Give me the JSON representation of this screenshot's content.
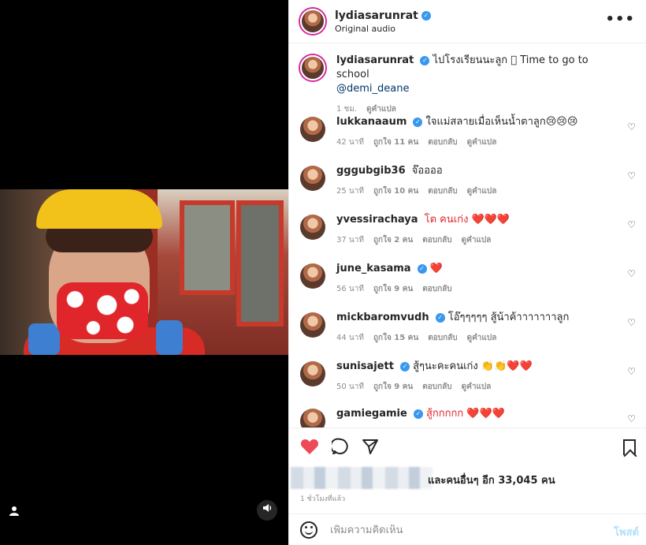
{
  "header": {
    "username": "lydiasarunrat",
    "subtitle": "Original audio",
    "more_label": "•••"
  },
  "caption": {
    "username": "lydiasarunrat",
    "text": "ไปโรงเรียนนะลูก 🏻 Time to go to school",
    "mention": "@demi_deane",
    "time": "1 ชม.",
    "translate": "ดูคำแปล"
  },
  "comments": [
    {
      "username": "lukkanaaum",
      "verified": true,
      "text": "ใจแม่สลายเมื่อเห็นน้ำตาลูก😢😢😢",
      "time": "42 นาที",
      "likes": "ถูกใจ 11 คน",
      "reply": "ตอบกลับ",
      "translate": "ดูคำแปล"
    },
    {
      "username": "gggubgib36",
      "verified": false,
      "text": "จ๊ออออ",
      "time": "25 นาที",
      "likes": "ถูกใจ 10 คน",
      "reply": "ตอบกลับ",
      "translate": "ดูคำแปล"
    },
    {
      "username": "yvessirachaya",
      "verified": false,
      "text": "โต คนเก่ง ❤️❤️❤️",
      "time": "37 นาที",
      "likes": "ถูกใจ 2 คน",
      "reply": "ตอบกลับ",
      "translate": "ดูคำแปล"
    },
    {
      "username": "june_kasama",
      "verified": true,
      "text": "❤️",
      "time": "56 นาที",
      "likes": "ถูกใจ 9 คน",
      "reply": "ตอบกลับ",
      "translate": ""
    },
    {
      "username": "mickbaromvudh",
      "verified": true,
      "text": "โอ๊ๆๆๆๆๆ สู้น้าค้าาาาาาาลูก",
      "time": "44 นาที",
      "likes": "ถูกใจ 15 คน",
      "reply": "ตอบกลับ",
      "translate": "ดูคำแปล"
    },
    {
      "username": "sunisajett",
      "verified": true,
      "text": "สู้ๆนะคะคนเก่ง 👏👏❤️❤️",
      "time": "50 นาที",
      "likes": "ถูกใจ 9 คน",
      "reply": "ตอบกลับ",
      "translate": "ดูคำแปล"
    },
    {
      "username": "gamiegamie",
      "verified": true,
      "text": "สู้กกกกก ❤️❤️❤️",
      "time": "",
      "likes": "",
      "reply": "",
      "translate": ""
    }
  ],
  "actions": {
    "likes_text": "และคนอื่นๆ อีก 33,045 คน",
    "time_ago": "1 ชั่วโมงที่แล้ว",
    "comment_placeholder": "เพิ่มความคิดเห็น",
    "post_label": "โพสต์"
  },
  "colors": {
    "verified": "#3897f0",
    "like_red": "#ed4956",
    "post_disabled": "#b2dffc"
  },
  "icons": {
    "like": "heart-filled-icon",
    "comment": "comment-icon",
    "share": "send-icon",
    "save": "bookmark-icon",
    "emoji": "smile-icon",
    "audio": "speaker-icon",
    "user_tag": "user-icon"
  }
}
